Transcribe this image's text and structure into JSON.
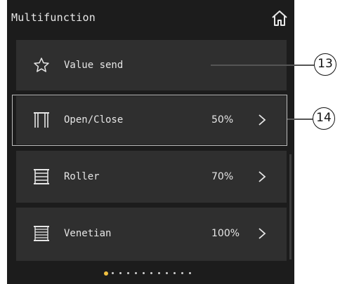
{
  "header": {
    "title": "Multifunction",
    "home_icon": "home-icon"
  },
  "rows": [
    {
      "label": "Value send",
      "icon": "star-icon",
      "value": ""
    },
    {
      "label": "Open/Close",
      "icon": "curtain-icon",
      "value": "50%"
    },
    {
      "label": "Roller",
      "icon": "roller-blind-icon",
      "value": "70%"
    },
    {
      "label": "Venetian",
      "icon": "venetian-blind-icon",
      "value": "100%"
    }
  ],
  "callouts": [
    "13",
    "14"
  ],
  "pagination": {
    "total": 12,
    "active_index": 0
  },
  "colors": {
    "background": "#1c1c1c",
    "row": "#2f2f2f",
    "active_dot": "#f0c040"
  }
}
